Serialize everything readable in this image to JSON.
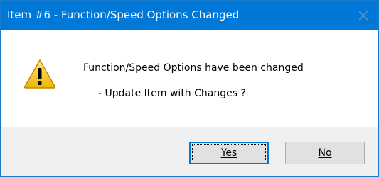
{
  "dialog": {
    "title": "Item #6 - Function/Speed Options Changed",
    "message_line1": "Function/Speed Options have been changed",
    "message_line2": "- Update Item with Changes ?",
    "icon": "warning-icon",
    "buttons": {
      "yes_label": "Yes",
      "no_label": "No"
    }
  },
  "colors": {
    "titlebar": "#0078d7",
    "title_text": "#ffffff",
    "footer": "#f0f0f0",
    "button": "#e1e1e1",
    "warning_fill": "#f7c62f"
  }
}
